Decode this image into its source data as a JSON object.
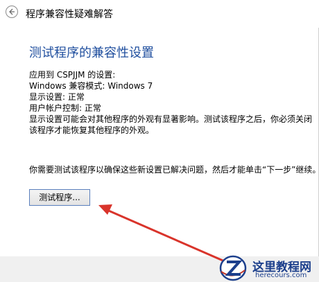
{
  "window": {
    "title": "程序兼容性疑难解答"
  },
  "main": {
    "heading": "测试程序的兼容性设置",
    "info_lines": [
      "应用到  CSPJJM 的设置:",
      "Windows 兼容模式: Windows 7",
      "显示设置:  正常",
      "用户帐户控制:  正常"
    ],
    "warning": "显示设置可能会对其他程序的外观有显著影响。测试该程序之后，你必须关闭该程序才能恢复其他程序的外观。",
    "instruction": "你需要测试该程序以确保这些新设置已解决问题，然后才能单击“下一步”继续。",
    "test_button_label": "测试程序..."
  },
  "watermark": {
    "title": "这里教程网",
    "url": "herecours.com"
  },
  "colors": {
    "heading": "#1f4e9e",
    "arrow": "#d9342b",
    "button_border": "#5a7fbd"
  },
  "icons": {
    "back": "back-arrow-icon",
    "annotation": "red-arrow-icon",
    "logo": "z-logo-icon"
  }
}
